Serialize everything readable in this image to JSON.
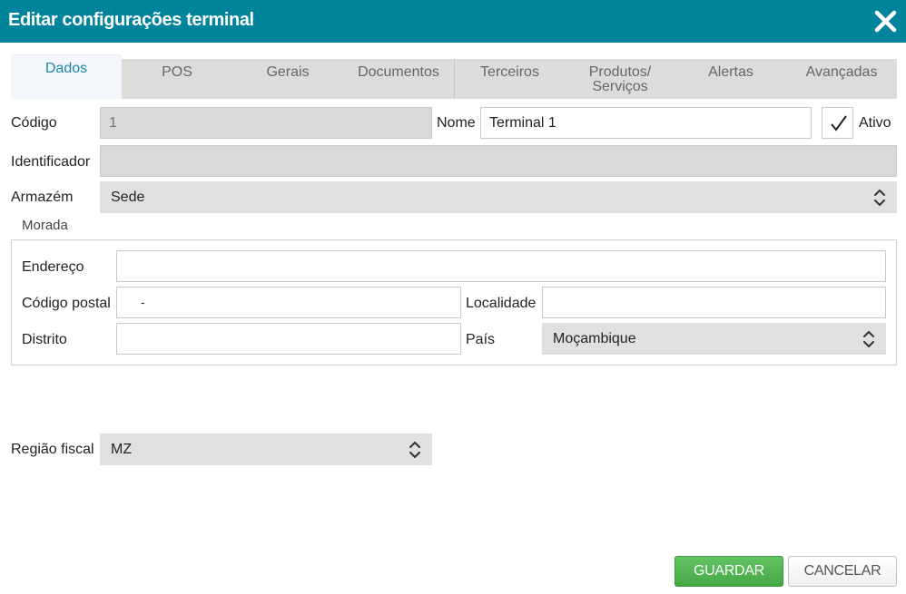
{
  "dialog": {
    "title": "Editar configurações terminal"
  },
  "tabs": [
    {
      "label": "Dados"
    },
    {
      "label": "POS"
    },
    {
      "label": "Gerais"
    },
    {
      "label": "Documentos"
    },
    {
      "label": "Terceiros"
    },
    {
      "label": "Produtos/\nServiços"
    },
    {
      "label": "Alertas"
    },
    {
      "label": "Avançadas"
    }
  ],
  "form": {
    "codigo_label": "Código",
    "codigo_placeholder": "1",
    "nome_label": "Nome",
    "nome_value": "Terminal 1",
    "ativo_label": "Ativo",
    "ativo_checked": true,
    "identificador_label": "Identificador",
    "identificador_value": "",
    "armazem_label": "Armazém",
    "armazem_value": "Sede",
    "morada": {
      "legend": "Morada",
      "endereco_label": "Endereço",
      "endereco_value": "",
      "codigo_postal_label": "Código postal",
      "codigo_postal_value": "-",
      "localidade_label": "Localidade",
      "localidade_value": "",
      "distrito_label": "Distrito",
      "distrito_value": "",
      "pais_label": "País",
      "pais_value": "Moçambique"
    },
    "regiao_fiscal_label": "Região fiscal",
    "regiao_fiscal_value": "MZ"
  },
  "buttons": {
    "save": "GUARDAR",
    "cancel": "CANCELAR"
  },
  "colors": {
    "header": "#00849b",
    "active_tab_text": "#1e88a8",
    "save_button": "#4cb34c"
  }
}
